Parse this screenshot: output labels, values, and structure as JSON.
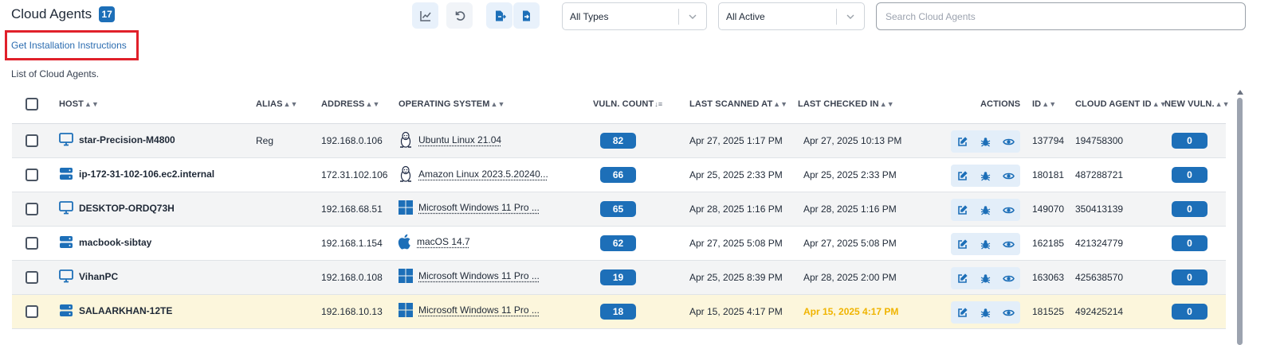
{
  "header": {
    "title": "Cloud Agents",
    "count": "17",
    "install_link": "Get Installation Instructions",
    "list_caption": "List of Cloud Agents."
  },
  "toolbar": {
    "buttons": [
      {
        "name": "chart-button",
        "icon": "line-chart-icon"
      },
      {
        "name": "refresh-button",
        "icon": "undo-icon"
      },
      {
        "name": "export-button",
        "icon": "file-export-icon"
      },
      {
        "name": "import-button",
        "icon": "file-import-icon"
      }
    ],
    "type_filter": "All Types",
    "status_filter": "All Active",
    "search_placeholder": "Search Cloud Agents"
  },
  "table": {
    "columns": {
      "host": "HOST",
      "alias": "ALIAS",
      "address": "ADDRESS",
      "os": "OPERATING SYSTEM",
      "vuln": "VULN. COUNT",
      "scanned": "LAST SCANNED AT",
      "checked": "LAST CHECKED IN",
      "actions": "ACTIONS",
      "id": "ID",
      "agent_id": "CLOUD AGENT ID",
      "new_vuln": "NEW VULN."
    },
    "rows": [
      {
        "host": "star-Precision-M4800",
        "host_type": "desktop",
        "alias": "Reg",
        "address": "192.168.0.106",
        "os": "Ubuntu Linux 21.04",
        "os_icon": "linux",
        "vuln": "82",
        "scanned": "Apr 27, 2025 1:17 PM",
        "checked": "Apr 27, 2025 10:13 PM",
        "checked_warn": false,
        "id": "137794",
        "agent_id": "194758300",
        "new_vuln": "0"
      },
      {
        "host": "ip-172-31-102-106.ec2.internal",
        "host_type": "server",
        "alias": "",
        "address": "172.31.102.106",
        "os": "Amazon Linux 2023.5.20240...",
        "os_icon": "linux",
        "vuln": "66",
        "scanned": "Apr 25, 2025 2:33 PM",
        "checked": "Apr 25, 2025 2:33 PM",
        "checked_warn": false,
        "id": "180181",
        "agent_id": "487288721",
        "new_vuln": "0"
      },
      {
        "host": "DESKTOP-ORDQ73H",
        "host_type": "desktop",
        "alias": "",
        "address": "192.168.68.51",
        "os": "Microsoft Windows 11 Pro ...",
        "os_icon": "windows",
        "vuln": "65",
        "scanned": "Apr 28, 2025 1:16 PM",
        "checked": "Apr 28, 2025 1:16 PM",
        "checked_warn": false,
        "id": "149070",
        "agent_id": "350413139",
        "new_vuln": "0"
      },
      {
        "host": "macbook-sibtay",
        "host_type": "server",
        "alias": "",
        "address": "192.168.1.154",
        "os": "macOS 14.7",
        "os_icon": "apple",
        "vuln": "62",
        "scanned": "Apr 27, 2025 5:08 PM",
        "checked": "Apr 27, 2025 5:08 PM",
        "checked_warn": false,
        "id": "162185",
        "agent_id": "421324779",
        "new_vuln": "0"
      },
      {
        "host": "VihanPC",
        "host_type": "desktop",
        "alias": "",
        "address": "192.168.0.108",
        "os": "Microsoft Windows 11 Pro ...",
        "os_icon": "windows",
        "vuln": "19",
        "scanned": "Apr 25, 2025 8:39 PM",
        "checked": "Apr 28, 2025 2:00 PM",
        "checked_warn": false,
        "id": "163063",
        "agent_id": "425638570",
        "new_vuln": "0"
      },
      {
        "host": "SALAARKHAN-12TE",
        "host_type": "server",
        "alias": "",
        "address": "192.168.10.13",
        "os": "Microsoft Windows 11 Pro ...",
        "os_icon": "windows",
        "vuln": "18",
        "scanned": "Apr 15, 2025 4:17 PM",
        "checked": "Apr 15, 2025 4:17 PM",
        "checked_warn": true,
        "id": "181525",
        "agent_id": "492425214",
        "new_vuln": "0"
      }
    ]
  },
  "colors": {
    "accent": "#1d6fb8",
    "highlight_box": "#e0202a",
    "warning_text": "#f0b400",
    "highlight_row": "#fcf6dc"
  }
}
